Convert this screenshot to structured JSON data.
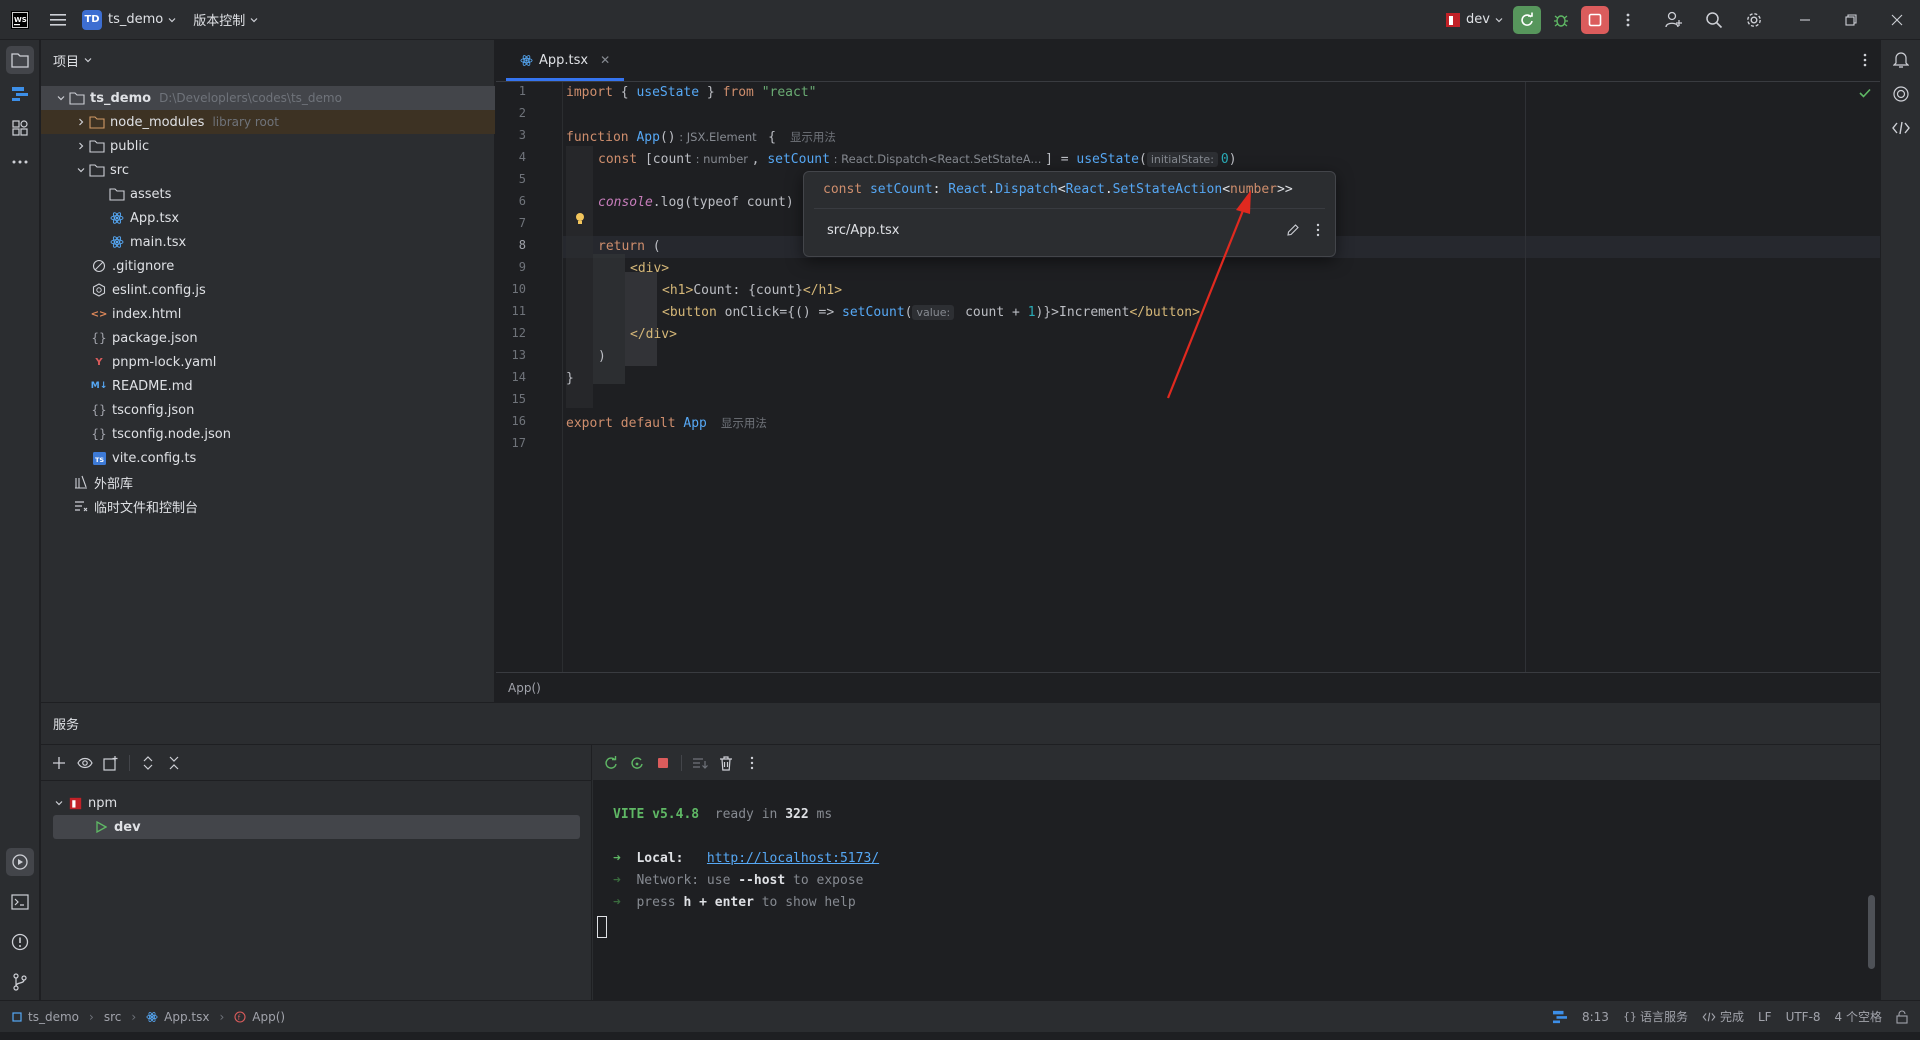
{
  "titlebar": {
    "project_badge": "TD",
    "project_name": "ts_demo",
    "vcs_label": "版本控制",
    "run_config": "dev"
  },
  "project_panel": {
    "title": "项目",
    "root": {
      "name": "ts_demo",
      "path": "D:\\Developlers\\codes\\ts_demo"
    },
    "items": [
      {
        "name": "node_modules",
        "hint": "library root"
      },
      {
        "name": "public"
      },
      {
        "name": "src"
      },
      {
        "name": "assets"
      },
      {
        "name": "App.tsx"
      },
      {
        "name": "main.tsx"
      },
      {
        "name": ".gitignore"
      },
      {
        "name": "eslint.config.js"
      },
      {
        "name": "index.html"
      },
      {
        "name": "package.json"
      },
      {
        "name": "pnpm-lock.yaml"
      },
      {
        "name": "README.md"
      },
      {
        "name": "tsconfig.json"
      },
      {
        "name": "tsconfig.node.json"
      },
      {
        "name": "vite.config.ts"
      },
      {
        "name": "外部库"
      },
      {
        "name": "临时文件和控制台"
      }
    ]
  },
  "editor": {
    "tab": "App.tsx",
    "line_numbers": [
      "1",
      "2",
      "3",
      "4",
      "5",
      "6",
      "7",
      "8",
      "9",
      "10",
      "11",
      "12",
      "13",
      "14",
      "15",
      "16",
      "17"
    ],
    "code": {
      "l1_import": "import",
      "l1_open": " { ",
      "l1_usestate": "useState",
      "l1_close": " } ",
      "l1_from": "from",
      "l1_str": " \"react\"",
      "l3_function": "function",
      "l3_name": " App",
      "l3_paren": "()",
      "l3_hint": " : JSX.Element ",
      "l3_brace": " {",
      "usage_hint": "显示用法",
      "l4_const": "const",
      "l4_bracket": " [count",
      "l4_hint_count": " : number ",
      "l4_comma": ", ",
      "l4_setcount": "setCount",
      "l4_hint_set": " : React.Dispatch<React.SetStateA... ",
      "l4_eq": "] = ",
      "l4_call": "useState",
      "l4_paren": "(",
      "l4_param": "initialState:",
      "l4_zero": "0",
      "l4_end": ")",
      "l6_console": "console",
      "l6_log": ".log(typeof count)",
      "l8_return": "return",
      "l8_paren": " (",
      "l9": "<div>",
      "l10_open": "<h1>",
      "l10_text": "Count: {count}",
      "l10_close": "</h1>",
      "l11_open": "<button",
      "l11_attr": " onClick={() => ",
      "l11_fn": "setCount",
      "l11_paren": "(",
      "l11_param": "value:",
      "l11_expr": " count + ",
      "l11_one": "1",
      "l11_end": ")}>Increment",
      "l11_close": "</button>",
      "l12": "</div>",
      "l13": ")",
      "l14": "}",
      "l16_export": "export default",
      "l16_app": " App"
    },
    "breadcrumb": "App()"
  },
  "popup": {
    "sig_const": "const ",
    "sig_name": "setCount",
    "sig_colon": ": ",
    "sig_react1": "React",
    "sig_dot1": ".",
    "sig_dispatch": "Dispatch",
    "sig_lt1": "<",
    "sig_react2": "React",
    "sig_dot2": ".",
    "sig_ssa": "SetStateAction",
    "sig_lt2": "<",
    "sig_number": "number",
    "sig_gt": ">>",
    "file": "src/App.tsx"
  },
  "services": {
    "title": "服务",
    "tree": [
      {
        "name": "npm"
      },
      {
        "name": "dev"
      }
    ],
    "terminal": {
      "vite": "VITE v5.4.8",
      "ready": "  ready in ",
      "ms_num": "322",
      "ms_unit": " ms",
      "arrow": "➜",
      "local_label": "  Local:   ",
      "local_url": "http://localhost:5173/",
      "network_label": "  Network: use ",
      "network_host": "--host",
      "network_rest": " to expose",
      "press": "  press ",
      "press_h": "h + enter",
      "press_rest": " to show help"
    }
  },
  "statusbar": {
    "crumbs": [
      "ts_demo",
      "src",
      "App.tsx",
      "App()"
    ],
    "position": "8:13",
    "language_service": "语言服务",
    "done": "完成",
    "line_sep": "LF",
    "encoding": "UTF-8",
    "indent": "4 个空格"
  }
}
